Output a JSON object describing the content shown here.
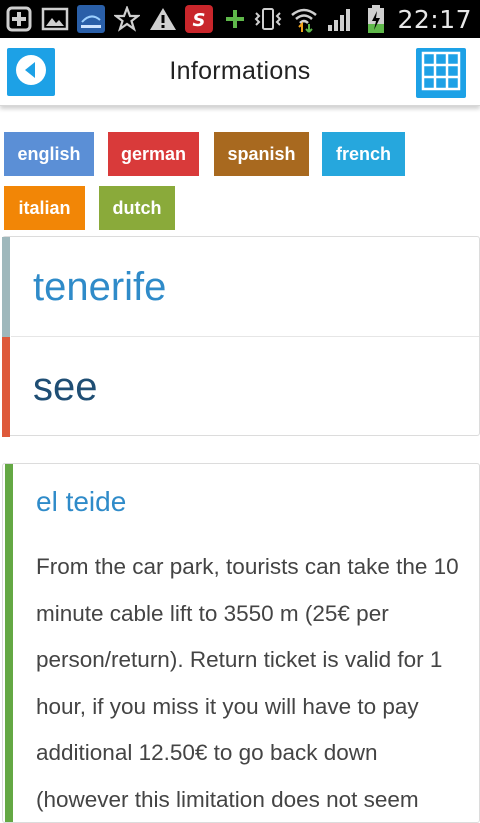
{
  "status_bar": {
    "time": "22:17",
    "icons": [
      "add-icon",
      "image-icon",
      "app-tile-icon",
      "star-icon",
      "warning-icon",
      "app-s-icon",
      "plus-icon",
      "vibrate-icon",
      "wifi-icon",
      "signal-icon",
      "battery-charging-icon"
    ]
  },
  "header": {
    "title": "Informations",
    "accent_color": "#1da1e6"
  },
  "languages": [
    {
      "label": "english",
      "color": "#5b8fd6"
    },
    {
      "label": "german",
      "color": "#d93a3a"
    },
    {
      "label": "spanish",
      "color": "#a8691f"
    },
    {
      "label": "french",
      "color": "#26a7dd"
    },
    {
      "label": "italian",
      "color": "#f28606"
    },
    {
      "label": "dutch",
      "color": "#8aaa3a"
    }
  ],
  "breadcrumb": {
    "place": "tenerife",
    "place_bar_color": "#9fb8bc",
    "category": "see",
    "category_bar_color": "#de5a3b"
  },
  "article": {
    "title": "el teide",
    "bar_color": "#64a844",
    "body": "From the car park, tourists can take the 10 minute cable lift to 3550 m (25€ per person/return). Return ticket is valid for 1 hour, if you miss it you will have to pay additional 12.50€ to go back down (however this limitation does not seem"
  }
}
